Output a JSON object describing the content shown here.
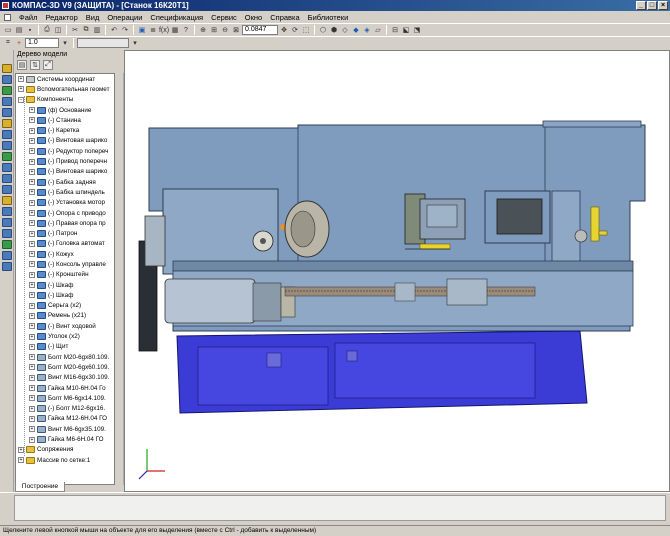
{
  "window": {
    "title": "КОМПАС-3D V9 (ЗАЩИТА) - [Станок 16К20Т1]"
  },
  "menu": {
    "items": [
      "Файл",
      "Редактор",
      "Вид",
      "Операции",
      "Спецификация",
      "Сервис",
      "Окно",
      "Справка",
      "Библиотеки"
    ]
  },
  "toolbar": {
    "zoom_value": "0.0847",
    "step_value": "1.0"
  },
  "tree": {
    "header": "Дерево модели",
    "tab": "Построение",
    "rows": [
      {
        "label": "Системы координат",
        "icon": "coordinate-icon",
        "level": 0
      },
      {
        "label": "Вспомогательная геомет",
        "icon": "folder-icon",
        "level": 0
      },
      {
        "label": "Компоненты",
        "icon": "folder-icon",
        "level": 0
      },
      {
        "label": "(ф) Основание",
        "icon": "part-icon",
        "level": 1
      },
      {
        "label": "(-) Станина",
        "icon": "part-icon",
        "level": 1
      },
      {
        "label": "(-) Каретка",
        "icon": "part-icon",
        "level": 1
      },
      {
        "label": "(-) Винтовая шарико",
        "icon": "part-icon",
        "level": 1
      },
      {
        "label": "(-) Редуктор попереч",
        "icon": "part-icon",
        "level": 1
      },
      {
        "label": "(-) Привод поперечн",
        "icon": "part-icon",
        "level": 1
      },
      {
        "label": "(-) Винтовая шарико",
        "icon": "part-icon",
        "level": 1
      },
      {
        "label": "(-) Бабка задняя",
        "icon": "part-icon",
        "level": 1
      },
      {
        "label": "(-) Бабка шпиндель",
        "icon": "part-icon",
        "level": 1
      },
      {
        "label": "(-) Установка мотор",
        "icon": "part-icon",
        "level": 1
      },
      {
        "label": "(-) Опора с приводо",
        "icon": "part-icon",
        "level": 1
      },
      {
        "label": "(-) Правая опора пр",
        "icon": "part-icon",
        "level": 1
      },
      {
        "label": "(-) Патрон",
        "icon": "part-icon",
        "level": 1
      },
      {
        "label": "(-) Головка автомат",
        "icon": "part-icon",
        "level": 1
      },
      {
        "label": "(-) Кожух",
        "icon": "part-icon",
        "level": 1
      },
      {
        "label": "(-) Консоль управле",
        "icon": "part-icon",
        "level": 1
      },
      {
        "label": "(-) Кронштейн",
        "icon": "part-icon",
        "level": 1
      },
      {
        "label": "(-) Шкаф",
        "icon": "part-icon",
        "level": 1
      },
      {
        "label": "(-) Шкаф",
        "icon": "part-icon",
        "level": 1
      },
      {
        "label": "Серьга (x2)",
        "icon": "part-icon",
        "level": 1
      },
      {
        "label": "Ремень (x21)",
        "icon": "part-icon",
        "level": 1
      },
      {
        "label": "(-) Винт ходовой",
        "icon": "part-icon",
        "level": 1
      },
      {
        "label": "Уголок (x2)",
        "icon": "part-icon",
        "level": 1
      },
      {
        "label": "(-) Щит",
        "icon": "part-icon",
        "level": 1
      },
      {
        "label": "Болт М20-6gx80.109.",
        "icon": "standard-part-icon",
        "level": 1
      },
      {
        "label": "Болт М20-6gx60.109.",
        "icon": "standard-part-icon",
        "level": 1
      },
      {
        "label": "Винт М16-6gx30.109.",
        "icon": "standard-part-icon",
        "level": 1
      },
      {
        "label": "Гайка М10-6Н.04 Го",
        "icon": "standard-part-icon",
        "level": 1
      },
      {
        "label": "Болт М6-6gx14.109.",
        "icon": "standard-part-icon",
        "level": 1
      },
      {
        "label": "(-) Болт М12-6gx16.",
        "icon": "standard-part-icon",
        "level": 1
      },
      {
        "label": "Гайка М12-6Н.04 ГО",
        "icon": "standard-part-icon",
        "level": 1
      },
      {
        "label": "Винт М6-6gx35.109.",
        "icon": "standard-part-icon",
        "level": 1
      },
      {
        "label": "Гайка М6-6Н.04 ГО",
        "icon": "standard-part-icon",
        "level": 1
      },
      {
        "label": "Сопряжения",
        "icon": "folder-icon",
        "level": 0
      },
      {
        "label": "Массив по сетке:1",
        "icon": "folder-icon",
        "level": 0
      }
    ]
  },
  "statusbar": {
    "text": "Щелкните левой кнопкой мыши на объекте для его выделения (вместе с Ctrl - добавить к выделенным)"
  },
  "colors": {
    "machine_body": "#7f9bbd",
    "machine_base": "#3b3bd6",
    "highlight_yellow": "#e8d430",
    "title_bar": "#0a246a"
  }
}
